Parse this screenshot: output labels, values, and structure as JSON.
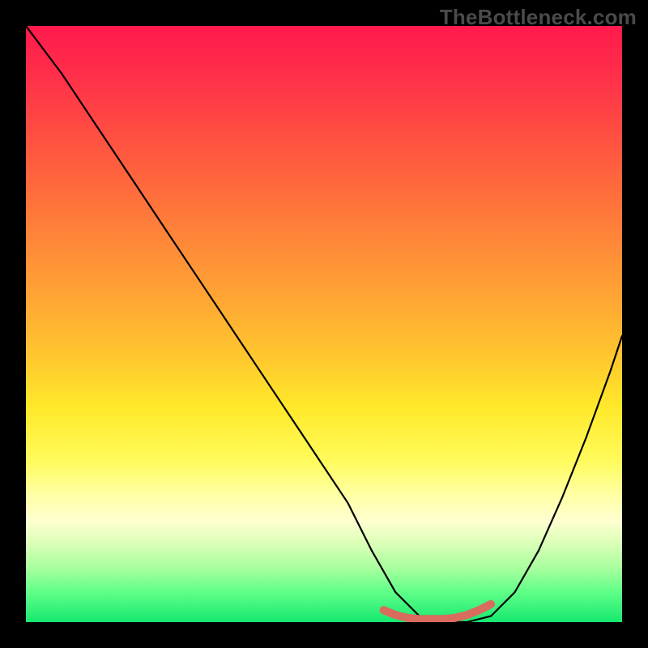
{
  "watermark": "TheBottleneck.com",
  "chart_data": {
    "type": "line",
    "title": "",
    "xlabel": "",
    "ylabel": "",
    "xlim": [
      0,
      100
    ],
    "ylim": [
      0,
      100
    ],
    "series": [
      {
        "name": "bottleneck-curve",
        "x": [
          0,
          6,
          12,
          18,
          24,
          30,
          36,
          42,
          48,
          54,
          58,
          62,
          66,
          70,
          74,
          78,
          82,
          86,
          90,
          94,
          98,
          100
        ],
        "values": [
          100,
          92,
          83,
          74,
          65,
          56,
          47,
          38,
          29,
          20,
          12,
          5,
          1,
          0,
          0,
          1,
          5,
          12,
          21,
          31,
          42,
          48
        ]
      },
      {
        "name": "trough-marker",
        "x": [
          60,
          62,
          64,
          66,
          68,
          70,
          72,
          74,
          76,
          78
        ],
        "values": [
          2,
          1.2,
          0.7,
          0.5,
          0.5,
          0.5,
          0.7,
          1.2,
          2,
          3
        ]
      }
    ],
    "annotations": [],
    "gradient_stops": [
      {
        "pos": 0.0,
        "color": "#ff1a4c"
      },
      {
        "pos": 0.32,
        "color": "#ff7a3a"
      },
      {
        "pos": 0.64,
        "color": "#ffe92a"
      },
      {
        "pos": 0.83,
        "color": "#ffffd0"
      },
      {
        "pos": 1.0,
        "color": "#16e86f"
      }
    ],
    "trough_marker_color": "#d96b5f"
  }
}
